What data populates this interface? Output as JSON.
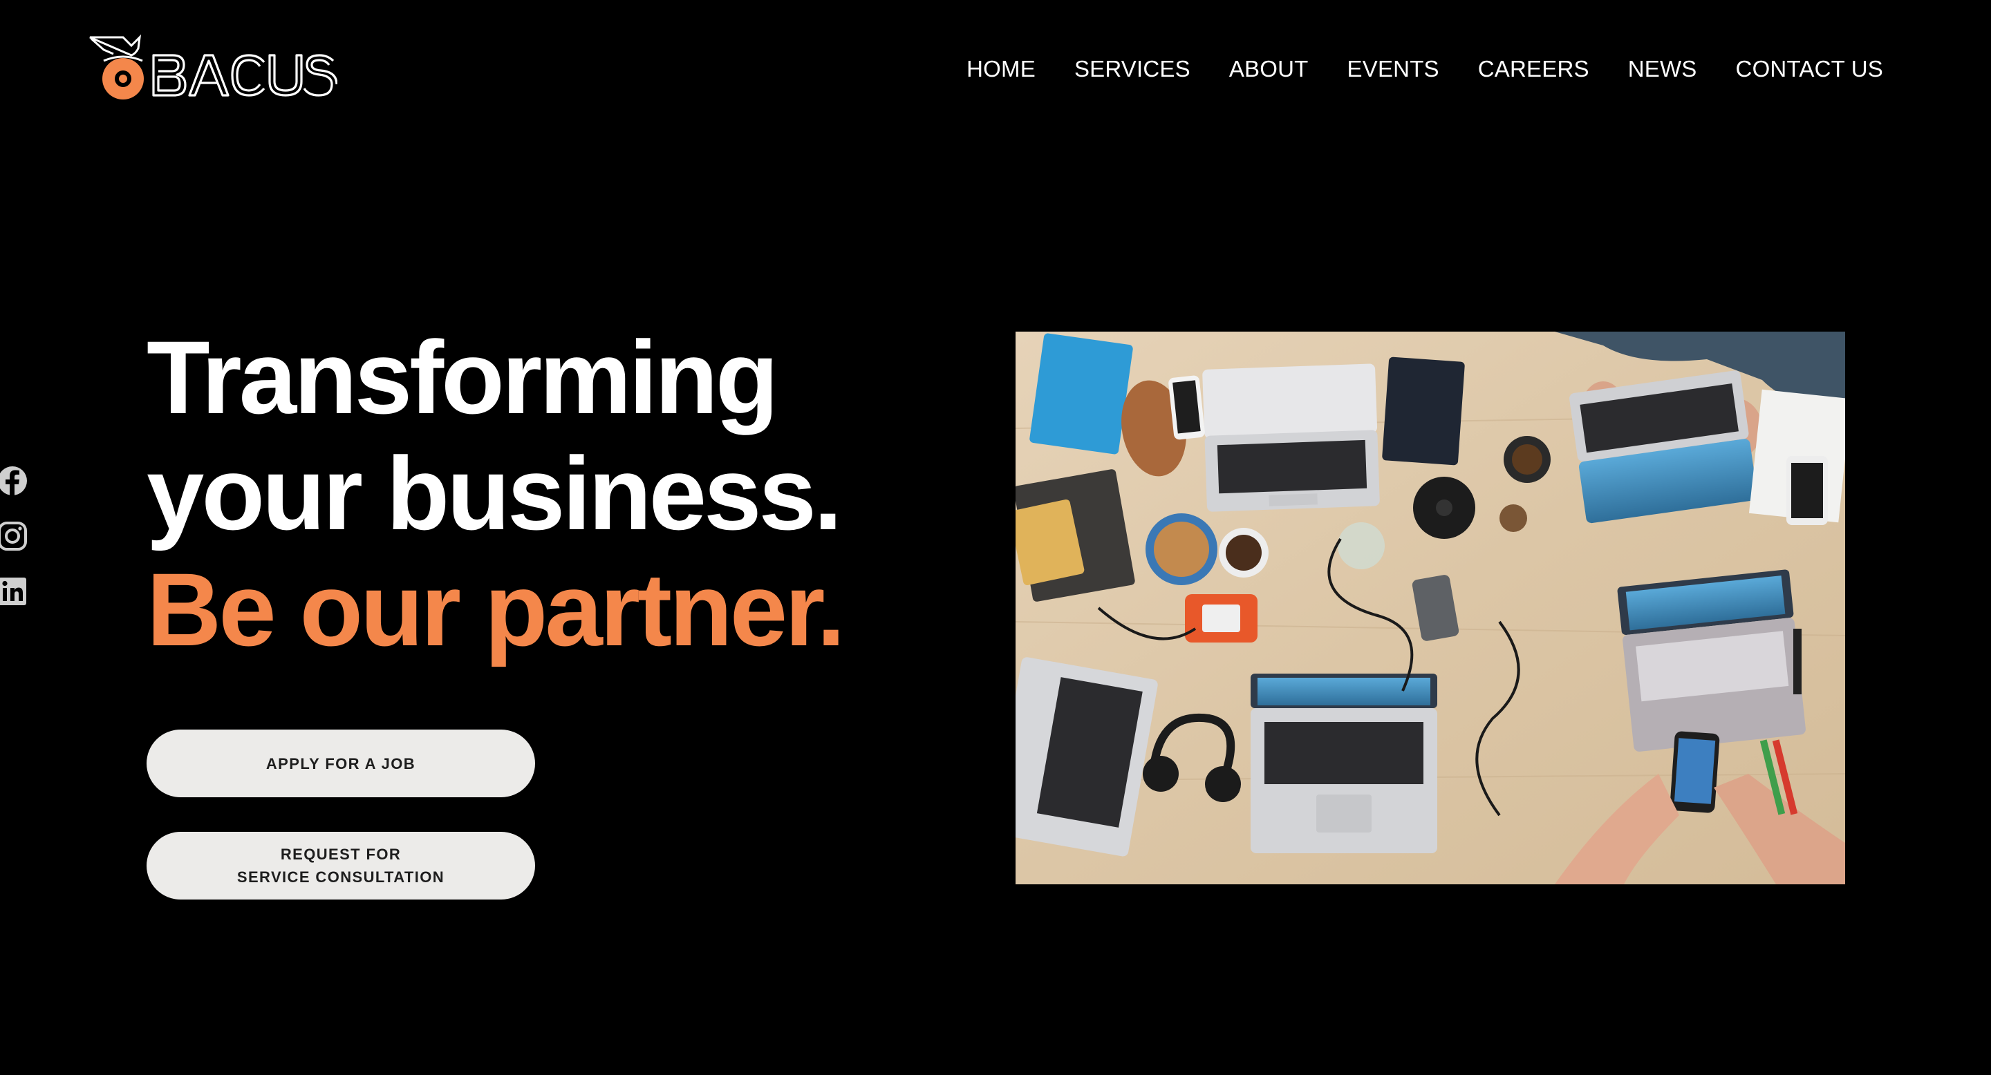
{
  "brand": {
    "name": "BACUS",
    "accent_color": "#F4874B"
  },
  "nav": {
    "items": [
      {
        "label": "HOME"
      },
      {
        "label": "SERVICES"
      },
      {
        "label": "ABOUT"
      },
      {
        "label": "EVENTS"
      },
      {
        "label": "CAREERS"
      },
      {
        "label": "NEWS"
      },
      {
        "label": "CONTACT US"
      }
    ]
  },
  "social": {
    "icons": [
      "facebook-icon",
      "instagram-icon",
      "linkedin-icon"
    ]
  },
  "hero": {
    "line1": "Transforming",
    "line2": "your business.",
    "line3": "Be our partner.",
    "image_subject": "team-workspace-photo"
  },
  "buttons": {
    "apply": "APPLY FOR A JOB",
    "request_line1": "REQUEST FOR",
    "request_line2": "SERVICE CONSULTATION"
  }
}
